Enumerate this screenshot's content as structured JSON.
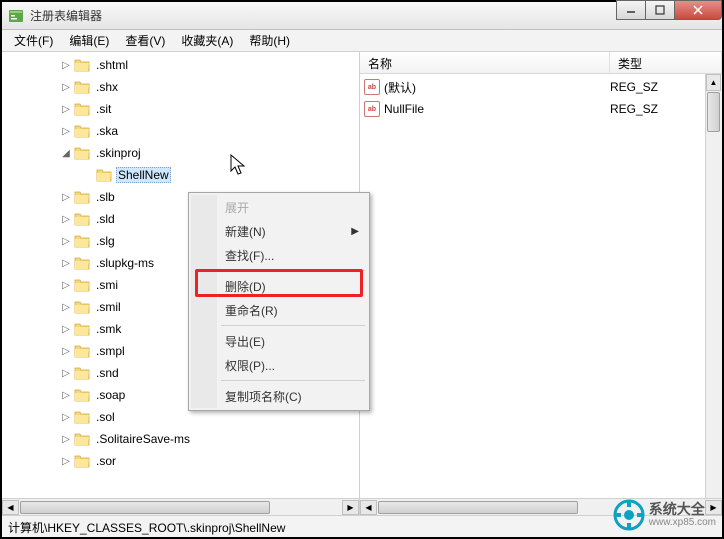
{
  "window": {
    "title": "注册表编辑器"
  },
  "menu": {
    "file": "文件(F)",
    "edit": "编辑(E)",
    "view": "查看(V)",
    "favorites": "收藏夹(A)",
    "help": "帮助(H)"
  },
  "tree": {
    "items": [
      {
        "label": ".shtml",
        "expander": "▷",
        "indent": 58
      },
      {
        "label": ".shx",
        "expander": "▷",
        "indent": 58
      },
      {
        "label": ".sit",
        "expander": "▷",
        "indent": 58
      },
      {
        "label": ".ska",
        "expander": "▷",
        "indent": 58
      },
      {
        "label": ".skinproj",
        "expander": "◢",
        "indent": 58
      },
      {
        "label": "ShellNew",
        "expander": "",
        "indent": 80,
        "selected": true
      },
      {
        "label": ".slb",
        "expander": "▷",
        "indent": 58
      },
      {
        "label": ".sld",
        "expander": "▷",
        "indent": 58
      },
      {
        "label": ".slg",
        "expander": "▷",
        "indent": 58
      },
      {
        "label": ".slupkg-ms",
        "expander": "▷",
        "indent": 58
      },
      {
        "label": ".smi",
        "expander": "▷",
        "indent": 58
      },
      {
        "label": ".smil",
        "expander": "▷",
        "indent": 58
      },
      {
        "label": ".smk",
        "expander": "▷",
        "indent": 58
      },
      {
        "label": ".smpl",
        "expander": "▷",
        "indent": 58
      },
      {
        "label": ".snd",
        "expander": "▷",
        "indent": 58
      },
      {
        "label": ".soap",
        "expander": "▷",
        "indent": 58
      },
      {
        "label": ".sol",
        "expander": "▷",
        "indent": 58
      },
      {
        "label": ".SolitaireSave-ms",
        "expander": "▷",
        "indent": 58
      },
      {
        "label": ".sor",
        "expander": "▷",
        "indent": 58
      }
    ]
  },
  "list": {
    "columns": {
      "name": "名称",
      "type": "类型"
    },
    "rows": [
      {
        "name": "(默认)",
        "type": "REG_SZ"
      },
      {
        "name": "NullFile",
        "type": "REG_SZ"
      }
    ]
  },
  "context_menu": {
    "expand": "展开",
    "new": "新建(N)",
    "find": "查找(F)...",
    "delete": "删除(D)",
    "rename": "重命名(R)",
    "export": "导出(E)",
    "permissions": "权限(P)...",
    "copy_key_name": "复制项名称(C)"
  },
  "statusbar": {
    "path": "计算机\\HKEY_CLASSES_ROOT\\.skinproj\\ShellNew"
  },
  "watermark": {
    "name": "系统大全",
    "url": "www.xp85.com"
  }
}
